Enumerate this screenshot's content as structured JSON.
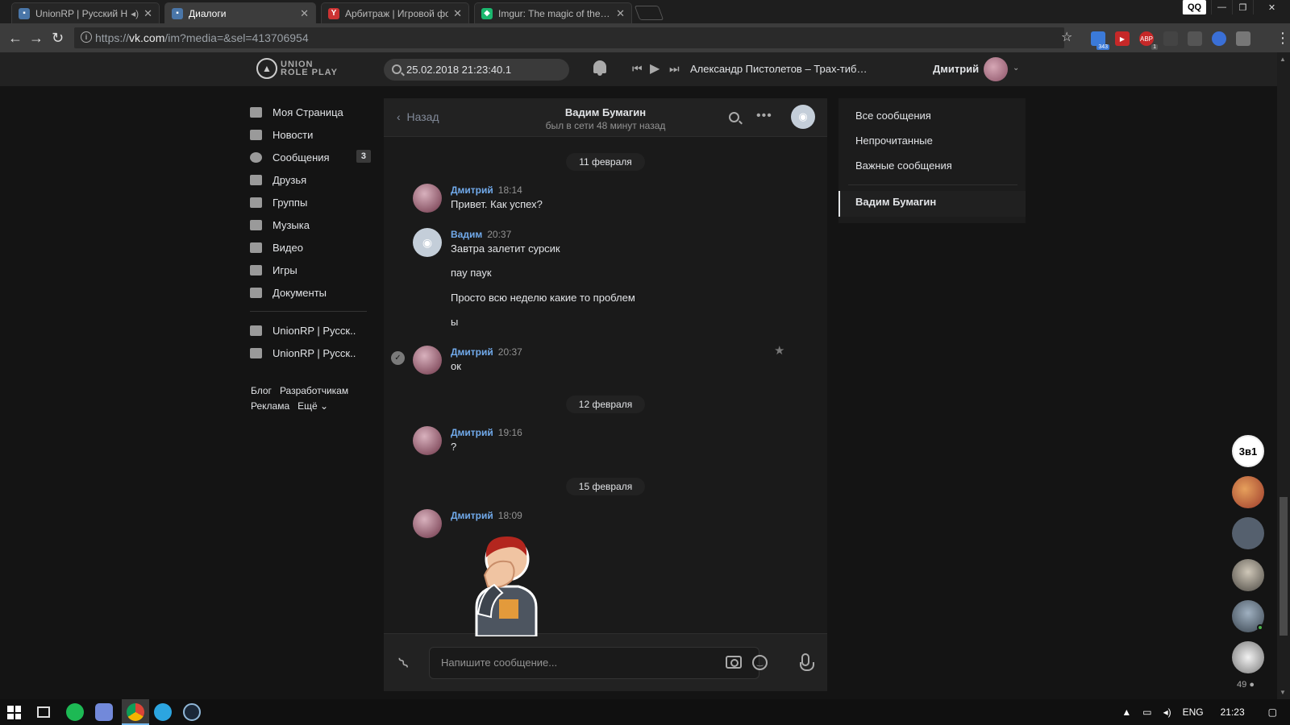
{
  "browser": {
    "tabs": [
      {
        "title": "UnionRP | Русский H…",
        "active": false
      },
      {
        "title": "Диалоги",
        "active": true
      },
      {
        "title": "Арбитраж | Игровой фо…",
        "active": false
      },
      {
        "title": "Imgur: The magic of the…",
        "active": false
      }
    ],
    "url_prefix": "https://",
    "url_domain": "vk.com",
    "url_path": "/im?media=&sel=413706954",
    "extensions": [
      {
        "label": "343",
        "color": "#3b7ad8"
      },
      {
        "label": "1",
        "color": "#d33"
      }
    ],
    "qq_label": "QQ"
  },
  "header": {
    "logo_text_1": "UNION",
    "logo_text_2": "ROLE PLAY",
    "search_value": "25.02.2018 21:23:40.1",
    "track": "Александр Пистолетов – Трах-тиб…",
    "user_name": "Дмитрий"
  },
  "left_menu": {
    "items": [
      {
        "label": "Моя Страница"
      },
      {
        "label": "Новости"
      },
      {
        "label": "Сообщения",
        "count": "3"
      },
      {
        "label": "Друзья"
      },
      {
        "label": "Группы"
      },
      {
        "label": "Музыка"
      },
      {
        "label": "Видео"
      },
      {
        "label": "Игры"
      },
      {
        "label": "Документы"
      }
    ],
    "groups": [
      {
        "label": "UnionRP | Русск.."
      },
      {
        "label": "UnionRP | Русск.."
      }
    ],
    "footer": [
      "Блог",
      "Разработчикам",
      "Реклама",
      "Ещё ⌄"
    ]
  },
  "chat": {
    "back_label": "Назад",
    "peer_name": "Вадим Бумагин",
    "peer_status": "был в сети 48 минут назад",
    "dates": [
      "11 февраля",
      "12 февраля",
      "15 февраля"
    ],
    "messages": [
      {
        "author": "Дмитрий",
        "time": "18:14",
        "lines": [
          "Привет. Как успех?"
        ]
      },
      {
        "author": "Вадим",
        "time": "20:37",
        "lines": [
          "Завтра залетит сурсик",
          "пау паук",
          "Просто всю неделю какие то проблем",
          "ы"
        ]
      },
      {
        "author": "Дмитрий",
        "time": "20:37",
        "lines": [
          "ок"
        ]
      },
      {
        "author": "Дмитрий",
        "time": "19:16",
        "lines": [
          "?"
        ]
      },
      {
        "author": "Дмитрий",
        "time": "18:09",
        "lines": []
      }
    ],
    "input_placeholder": "Напишите сообщение..."
  },
  "right_panel": {
    "items": [
      "Все сообщения",
      "Непрочитанные",
      "Важные сообщения"
    ],
    "active_dialog": "Вадим Бумагин"
  },
  "friends_online_count": "49",
  "taskbar": {
    "lang": "ENG",
    "time": "21:23"
  }
}
